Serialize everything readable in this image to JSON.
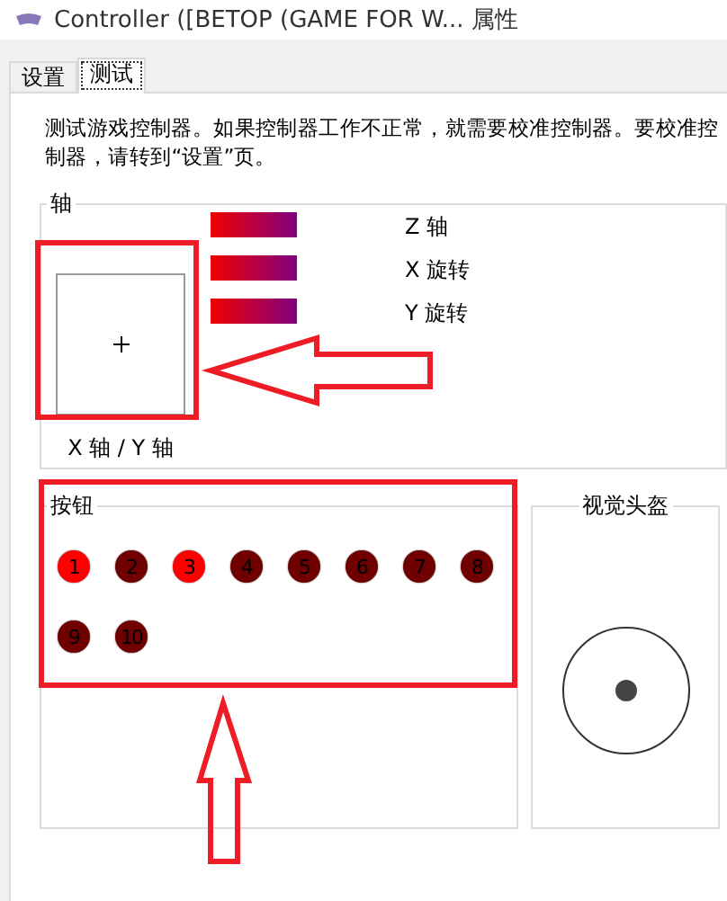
{
  "window": {
    "title": "Controller ([BETOP (GAME FOR W... 属性"
  },
  "tabs": [
    {
      "label": "设置",
      "selected": false
    },
    {
      "label": "测试",
      "selected": true
    }
  ],
  "description": "测试游戏控制器。如果控制器工作不正常，就需要校准控制器。要校准控制器，请转到“设置”页。",
  "axes": {
    "title": "轴",
    "xy_label": "X 轴 / Y 轴",
    "bars": [
      {
        "label": "Z 轴"
      },
      {
        "label": "X 旋转"
      },
      {
        "label": "Y 旋转"
      }
    ]
  },
  "buttons": {
    "title": "按钮",
    "items": [
      {
        "label": "1",
        "pressed": true
      },
      {
        "label": "2",
        "pressed": false
      },
      {
        "label": "3",
        "pressed": true
      },
      {
        "label": "4",
        "pressed": false
      },
      {
        "label": "5",
        "pressed": false
      },
      {
        "label": "6",
        "pressed": false
      },
      {
        "label": "7",
        "pressed": false
      },
      {
        "label": "8",
        "pressed": false
      },
      {
        "label": "9",
        "pressed": false
      },
      {
        "label": "10",
        "pressed": false
      }
    ]
  },
  "pov": {
    "title": "视觉头盔"
  }
}
